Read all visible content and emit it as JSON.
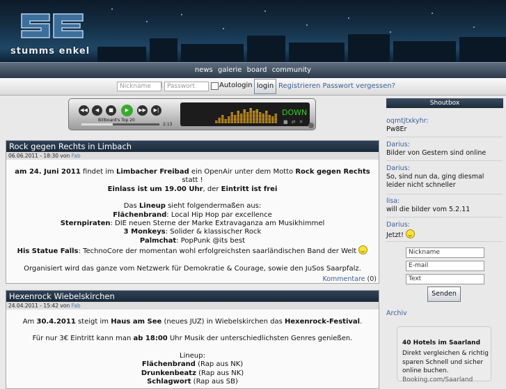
{
  "header": {
    "logo_text": "stumms enkel",
    "logo_mark": "SE"
  },
  "nav": {
    "items": [
      "news",
      "galerie",
      "board",
      "community"
    ]
  },
  "login": {
    "name_placeholder": "Nickname",
    "password_placeholder": "Passwort",
    "separator": "|",
    "autologin_label": "Autologin",
    "login_label": "login",
    "register_link": "Registrieren Passwort vergessen?"
  },
  "player": {
    "track_title": "Billboard's Top 20",
    "time": "2:13",
    "eq_text": "DOWN",
    "eq_bar_levels": [
      2,
      4,
      6,
      3,
      5,
      8,
      6,
      9,
      7,
      10,
      8,
      11,
      9,
      10,
      8,
      7,
      9,
      6,
      5,
      7
    ],
    "progress": 0.4
  },
  "articles": [
    {
      "title": "Rock gegen Rechts in Limbach",
      "date": "06.06.2011 - 18:30 von",
      "author": "Fab",
      "footer_link": "Kommentare",
      "footer_count": "(0)"
    },
    {
      "title": "Hexenrock Wiebelskirchen",
      "date": "24.04.2011 - 15:42 von",
      "author": "Fab"
    }
  ],
  "article1_body": {
    "l1a": "am 24. Juni 2011",
    "l1b": " findet im ",
    "l1c": "Limbacher Freibad",
    "l1d": " ein OpenAir unter dem Motto ",
    "l1e": "Rock gegen Rechts",
    "l1f": " statt !",
    "l2a": "Einlass ist um 19.00 Uhr",
    "l2b": ", der ",
    "l2c": "Eintritt ist frei",
    "l3a": "Das ",
    "l3b": "Lineup",
    "l3c": " sieht folgendermaßen aus:",
    "b1name": "Flächenbrand",
    "b1desc": ": Local Hip Hop par excellence",
    "b2name": "Sternpiraten",
    "b2desc": ": DIE neuen Sterne der Marke Extravaganza am Musikhimmel",
    "b3name": "3 Monkeys",
    "b3desc": ": Solider & klassischer Rock",
    "b4name": "Palmchat",
    "b4desc": ": PopPunk @its best",
    "b5name": "His Statue Falls",
    "b5desc": ": TechnoCore der momentan wohl erfolgreichsten saarländischen Band der Welt",
    "org": "Organisiert wird das ganze vom Netzwerk für Demokratie & Courage, sowie den JuSos Saarpfalz."
  },
  "article2_body": {
    "l1a": "Am ",
    "l1b": "30.4.2011",
    "l1c": " steigt im ",
    "l1d": "Haus am See",
    "l1e": " (neues JUZ) in Wiebelskirchen das ",
    "l1f": "Hexenrock-Festival",
    "l1g": ".",
    "l2a": "Für nur 3€ Eintritt kann man ",
    "l2b": "ab 18:00",
    "l2c": " Uhr Musik der unterschiedlichsten Genres genießen.",
    "lineup": "Lineup:",
    "b1name": "Flächenbrand",
    "b1desc": " (Rap aus NK)",
    "b2name": "Drunkenbeatz",
    "b2desc": " (Rap aus NK)",
    "b3name": "Schlagwort",
    "b3desc": " (Rap aus SB)"
  },
  "shoutbox": {
    "header": "Shoutbox",
    "entries": [
      {
        "user": "oqmtjtxkyhr:",
        "text": "Pw8Er"
      },
      {
        "user": "Darius:",
        "text": "Bilder von Gestern sind online"
      },
      {
        "user": "Darius:",
        "text": "So, sind nun da, ging diesmal leider nicht schneller"
      },
      {
        "user": "lisa:",
        "text": "will die bilder vom 5.2.11"
      },
      {
        "user": "Darius:",
        "text": "Jetzt!"
      }
    ],
    "name_value": "Nickname",
    "email_value": "E-mail",
    "text_value": "Text",
    "send_label": "Senden",
    "archive_link": "Archiv"
  },
  "ad": {
    "title": "40 Hotels im Saarland",
    "text": "Direkt vergleichen & richtig sparen Schnell und sicher online buchen.",
    "more": "Booking.com/Saarland"
  },
  "colors": {
    "accent_link": "#3a5f9a",
    "title_bar": "#1b2a3a",
    "play_green": "#3aa82e",
    "eq_green": "#36d22b"
  }
}
